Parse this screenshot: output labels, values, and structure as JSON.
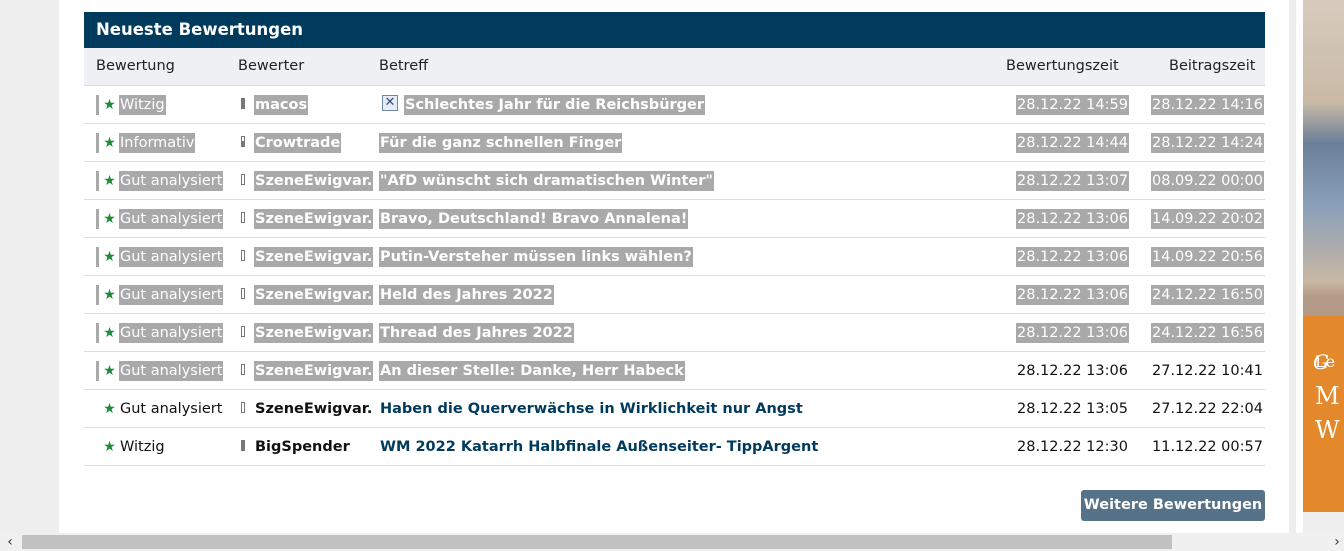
{
  "panel": {
    "title": "Neueste Bewertungen"
  },
  "columns": {
    "rating": "Bewertung",
    "rater": "Bewerter",
    "subject": "Betreff",
    "rated_at": "Bewertungszeit",
    "posted_at": "Beitragszeit"
  },
  "rows": [
    {
      "rating": "Witzig",
      "rater": "macos",
      "subject": "Schlechtes Jahr für die Reichsbürger",
      "rated_at": "28.12.22 14:59",
      "posted_at": "28.12.22 14:16"
    },
    {
      "rating": "Informativ",
      "rater": "Crowtrade",
      "subject": "Für die ganz schnellen Finger",
      "rated_at": "28.12.22 14:44",
      "posted_at": "28.12.22 14:24"
    },
    {
      "rating": "Gut analysiert",
      "rater": "SzeneEwigvar.",
      "subject": "\"AfD wünscht sich dramatischen Winter\"",
      "rated_at": "28.12.22 13:07",
      "posted_at": "08.09.22 00:00"
    },
    {
      "rating": "Gut analysiert",
      "rater": "SzeneEwigvar.",
      "subject": "Bravo, Deutschland! Bravo Annalena!",
      "rated_at": "28.12.22 13:06",
      "posted_at": "14.09.22 20:02"
    },
    {
      "rating": "Gut analysiert",
      "rater": "SzeneEwigvar.",
      "subject": "Putin-Versteher müssen links wählen?",
      "rated_at": "28.12.22 13:06",
      "posted_at": "14.09.22 20:56"
    },
    {
      "rating": "Gut analysiert",
      "rater": "SzeneEwigvar.",
      "subject": "Held des Jahres 2022",
      "rated_at": "28.12.22 13:06",
      "posted_at": "24.12.22 16:50"
    },
    {
      "rating": "Gut analysiert",
      "rater": "SzeneEwigvar.",
      "subject": "Thread des Jahres 2022",
      "rated_at": "28.12.22 13:06",
      "posted_at": "24.12.22 16:56"
    },
    {
      "rating": "Gut analysiert",
      "rater": "SzeneEwigvar.",
      "subject": "An dieser Stelle: Danke, Herr Habeck",
      "rated_at": "28.12.22 13:06",
      "posted_at": "27.12.22 10:41"
    },
    {
      "rating": "Gut analysiert",
      "rater": "SzeneEwigvar.",
      "subject": "Haben die Querverwächse in Wirklichkeit nur Angst",
      "rated_at": "28.12.22 13:05",
      "posted_at": "27.12.22 22:04"
    },
    {
      "rating": "Witzig",
      "rater": "BigSpender",
      "subject": "WM 2022 Katarrh Halbfinale Außenseiter- TippArgent",
      "rated_at": "28.12.22 12:30",
      "posted_at": "11.12.22 00:57"
    }
  ],
  "more_button": "Weitere Bewertungen",
  "ad": {
    "line1": "Le",
    "line2": "M",
    "line3": "W"
  },
  "icons": {
    "rating": "star-icon",
    "rater": "rank-bar-icon",
    "subject_first": "image-placeholder-icon",
    "scroll_left": "chevron-left-icon",
    "scroll_right": "chevron-right-icon"
  },
  "colors": {
    "header": "#003a5d",
    "star": "#1f8a3a",
    "button": "#557288",
    "link": "#003a5d",
    "selection": "#a9a9a9"
  }
}
